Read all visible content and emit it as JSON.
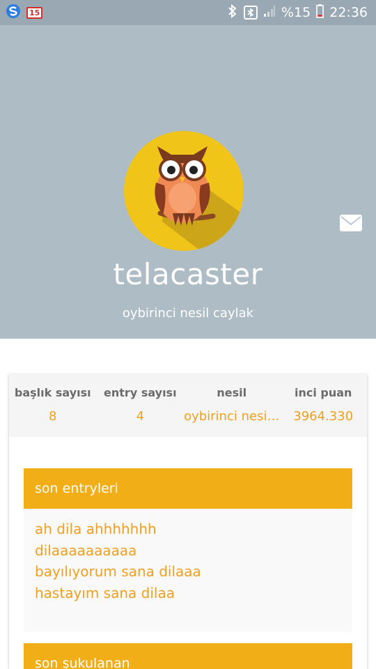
{
  "status_bar": {
    "notification_badge": "15",
    "battery_percent": "%15",
    "time": "22:36"
  },
  "profile": {
    "username": "telacaster",
    "subtitle": "oybirinci nesil caylak"
  },
  "stats": [
    {
      "label": "başlık sayısı",
      "value": "8"
    },
    {
      "label": "entry sayısı",
      "value": "4"
    },
    {
      "label": "nesil",
      "value": "oybirinci nesi…"
    },
    {
      "label": "inci puan",
      "value": "3964.330"
    }
  ],
  "recent_entries": {
    "title": "son entryleri",
    "items": [
      "ah dila ahhhhhhh",
      "dilaaaaaaaaaa",
      "bayılıyorum sana dilaaa",
      "hastayım sana dilaa"
    ]
  },
  "next_section": {
    "title": "son şukulanan"
  },
  "colors": {
    "header_bg": "#adbcc5",
    "accent": "#f2ae17",
    "accent_text": "#f0a020",
    "avatar_bg": "#f0c419"
  }
}
